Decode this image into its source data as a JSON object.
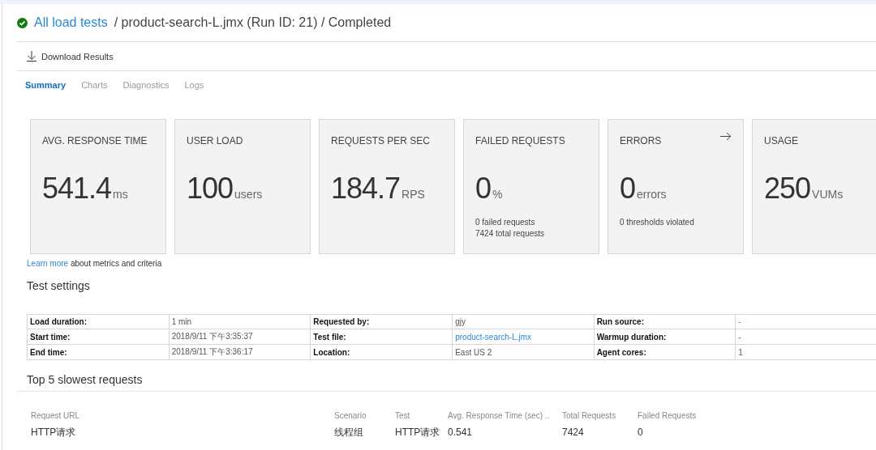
{
  "breadcrumb": {
    "succeeded": true,
    "link": "All load tests",
    "trail": "/ product-search-L.jmx (Run ID: 21) / Completed"
  },
  "toolbar": {
    "download": "Download Results"
  },
  "tabs": [
    {
      "label": "Summary",
      "selected": true
    },
    {
      "label": "Charts",
      "selected": false
    },
    {
      "label": "Diagnostics",
      "selected": false
    },
    {
      "label": "Logs",
      "selected": false
    }
  ],
  "metrics": [
    {
      "title": "AVG. RESPONSE TIME",
      "value": "541.4",
      "unit": "ms",
      "kind": "plain"
    },
    {
      "title": "USER LOAD",
      "value": "100",
      "unit": "users",
      "kind": "plain"
    },
    {
      "title": "REQUESTS PER SEC",
      "value": "184.7",
      "unit": "RPS",
      "kind": "plain"
    },
    {
      "title": "FAILED REQUESTS",
      "value": "0",
      "unit": "%",
      "notes": [
        "0 failed requests",
        "7424 total requests"
      ],
      "kind": "plain"
    },
    {
      "title": "ERRORS",
      "value": "0",
      "unit": "errors",
      "notes": [
        "0 thresholds violated"
      ],
      "kind": "link"
    },
    {
      "title": "USAGE",
      "value": "250",
      "unit": "VUMs",
      "kind": "plain"
    }
  ],
  "learn_more": {
    "link": "Learn more",
    "text": "about metrics and criteria"
  },
  "test_settings": {
    "title": "Test settings",
    "rows": [
      [
        {
          "label": "Load duration:",
          "value": "1 min",
          "kind": "text"
        },
        {
          "label": "Requested by:",
          "value": "gjy",
          "kind": "text"
        },
        {
          "label": "Run source:",
          "value": "-",
          "kind": "link"
        }
      ],
      [
        {
          "label": "Start time:",
          "value": "2018/9/11 下午3:35:37",
          "kind": "text"
        },
        {
          "label": "Test file:",
          "value": "product-search-L.jmx",
          "kind": "link"
        },
        {
          "label": "Warmup duration:",
          "value": "-",
          "kind": "text"
        }
      ],
      [
        {
          "label": "End time:",
          "value": "2018/9/11 下午3:36:17",
          "kind": "text"
        },
        {
          "label": "Location:",
          "value": "East US 2",
          "kind": "text"
        },
        {
          "label": "Agent cores:",
          "value": "1",
          "kind": "text"
        }
      ]
    ]
  },
  "slowest": {
    "title": "Top 5 slowest requests",
    "columns": [
      "Request URL",
      "Scenario",
      "Test",
      "Avg. Response Time (sec) ..",
      "Total Requests",
      "Failed Requests"
    ],
    "rows": [
      [
        "HTTP请求",
        "线程组",
        "HTTP请求",
        "0.541",
        "7424",
        "0"
      ]
    ]
  }
}
